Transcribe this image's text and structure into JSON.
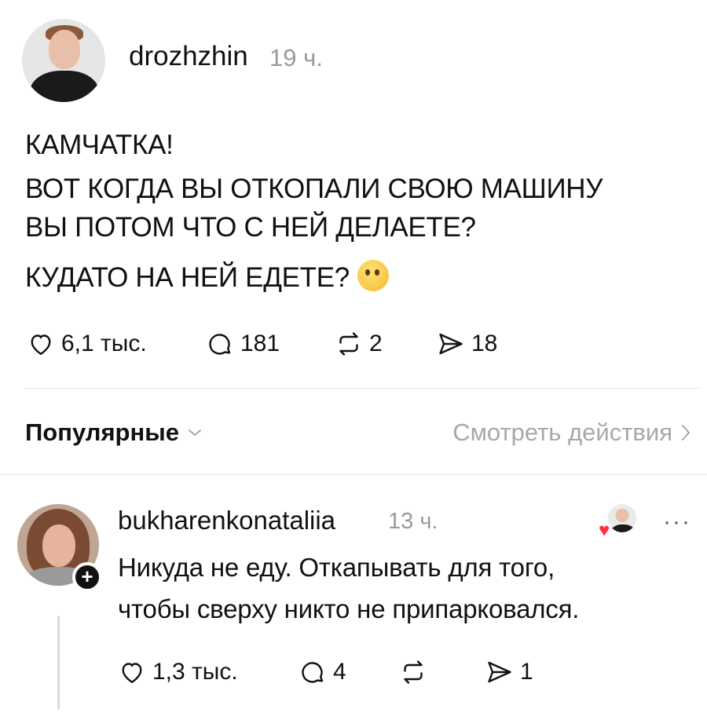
{
  "post": {
    "username": "drozhzhin",
    "time": "19 ч.",
    "lines": [
      "КАМЧАТКА!",
      "ВОТ КОГДА ВЫ ОТКОПАЛИ СВОЮ МАШИНУ",
      "ВЫ ПОТОМ ЧТО С НЕЙ ДЕЛАЕТЕ?",
      "КУДАТО НА НЕЙ ЕДЕТЕ?"
    ],
    "emoji": "thinking-face-emoji",
    "actions": {
      "likes": "6,1 тыс.",
      "replies": "181",
      "reposts": "2",
      "shares": "18"
    }
  },
  "replies_header": {
    "sort_label": "Популярные",
    "view_activity": "Смотреть действия"
  },
  "comment": {
    "username": "bukharenkonataliia",
    "time": "13 ч.",
    "lines": [
      "Никуда не еду. Откапывать для того,",
      "чтобы сверху никто не припарковался."
    ],
    "follow_symbol": "+",
    "more_symbol": "···",
    "liked_by_author_icon": "heart-icon",
    "actions": {
      "likes": "1,3 тыс.",
      "replies": "4",
      "reposts": "",
      "shares": "1"
    }
  },
  "colors": {
    "text": "#111111",
    "muted": "#9a9a9a",
    "divider": "#e4e4e4",
    "heart": "#ff3040"
  }
}
